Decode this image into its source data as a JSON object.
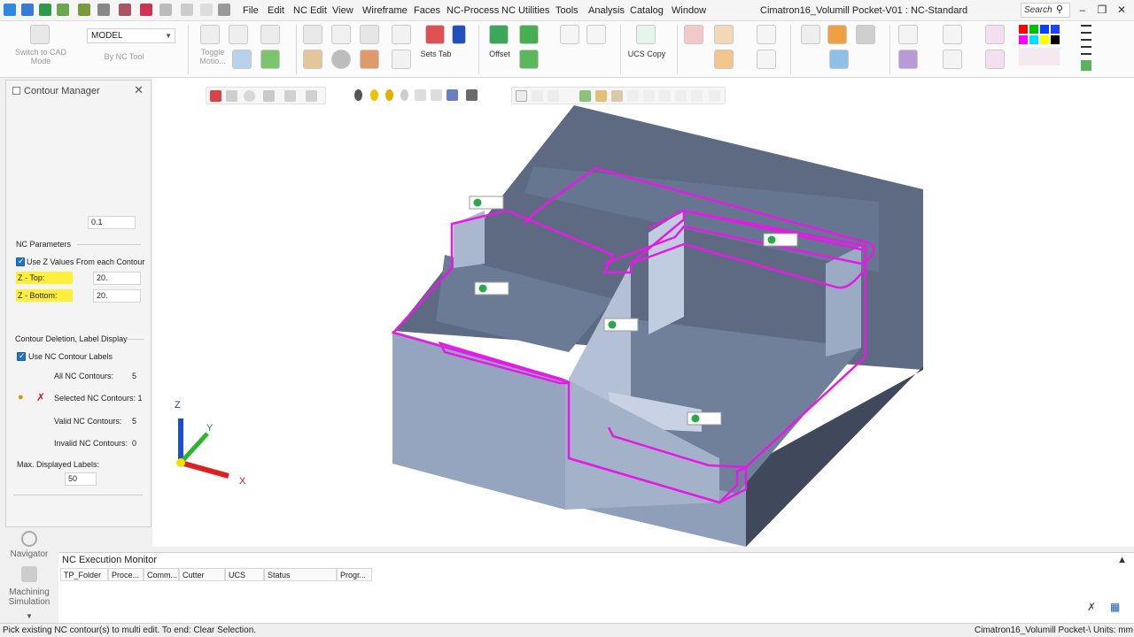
{
  "window": {
    "title": "Cimatron16_Volumill Pocket-V01 : NC-Standard",
    "search_placeholder": "Search"
  },
  "menu": {
    "items": [
      "File",
      "Edit",
      "NC Edit",
      "View",
      "Wireframe",
      "Faces",
      "NC-Process",
      "NC Utilities",
      "Tools",
      "Analysis",
      "Catalog",
      "Window"
    ]
  },
  "ribbon": {
    "switch_to_cad_label": "Switch to CAD Mode",
    "model_select_value": "MODEL",
    "by_nc_tool_label": "By NC Tool",
    "toggle_motion_label": "Toggle Motio...",
    "sets_tab_label": "Sets Tab",
    "offset_label": "Offset",
    "ucs_copy_label": "UCS Copy"
  },
  "contour_manager": {
    "title": "Contour Manager",
    "tolerance_value": "0.1",
    "nc_parameters_heading": "NC Parameters",
    "use_z_values_label": "Use Z Values From each Contour",
    "z_top_label": "Z - Top:",
    "z_top_value": "20.",
    "z_bottom_label": "Z - Bottom:",
    "z_bottom_value": "20.",
    "deletion_heading": "Contour Deletion, Label Display",
    "use_nc_labels_label": "Use NC Contour Labels",
    "all_nc_contours_label": "All NC Contours:",
    "all_nc_contours_value": "5",
    "selected_nc_contours_label": "Selected NC Contours: 1",
    "valid_nc_contours_label": "Valid NC Contours:",
    "valid_nc_contours_value": "5",
    "invalid_nc_contours_label": "Invalid NC Contours:",
    "invalid_nc_contours_value": "0",
    "max_labels_label": "Max. Displayed Labels:",
    "max_labels_value": "50"
  },
  "left_strip": {
    "navigator_label": "Navigator",
    "machining_simulation_label": "Machining Simulation"
  },
  "viewport": {
    "axis_x": "X",
    "axis_y": "Y",
    "axis_z": "Z"
  },
  "nc_monitor": {
    "title": "NC Execution Monitor",
    "columns": [
      "TP_Folder",
      "Proce...",
      "Comm...",
      "Cutter",
      "UCS",
      "Status",
      "Progr..."
    ]
  },
  "status_bar": {
    "message": "Pick existing NC contour(s) to multi edit. To end: Clear Selection.",
    "right_text": "Cimatron16_Volumill Pocket-\\  Units: mm"
  },
  "colors": {
    "contour_highlight": "#e619e6",
    "part_face": "#7e8fa8",
    "part_dark": "#4f5b6e",
    "z_field_highlight": "#ffef3a"
  }
}
